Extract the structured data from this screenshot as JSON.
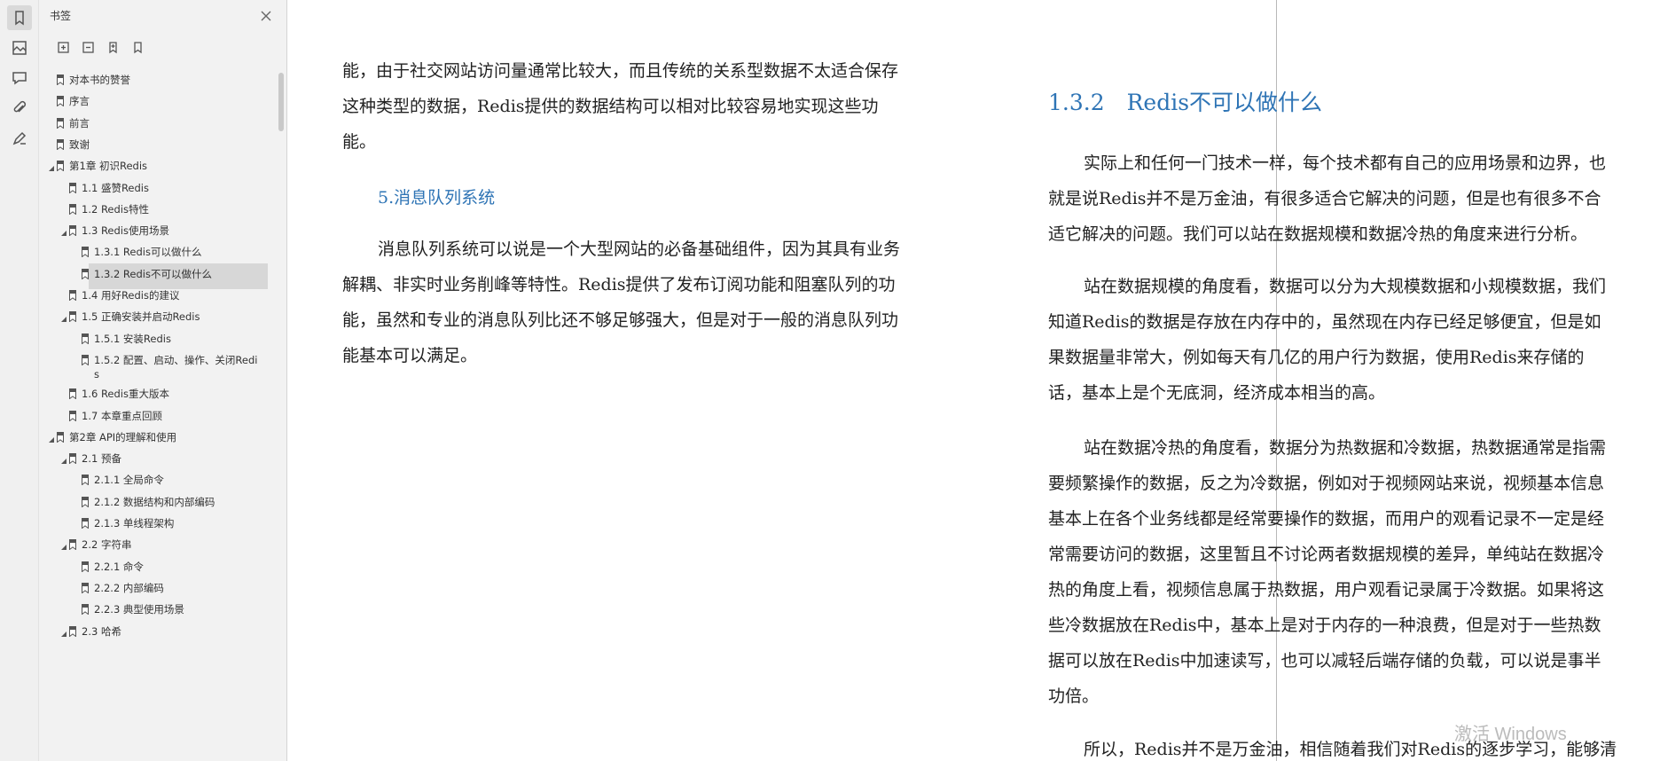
{
  "panel": {
    "title": "书签",
    "tree": [
      {
        "label": "对本书的赞誉",
        "level": 0,
        "expanded": null
      },
      {
        "label": "序言",
        "level": 0,
        "expanded": null
      },
      {
        "label": "前言",
        "level": 0,
        "expanded": null
      },
      {
        "label": "致谢",
        "level": 0,
        "expanded": null
      },
      {
        "label": "第1章 初识Redis",
        "level": 0,
        "expanded": true
      },
      {
        "label": "1.1 盛赞Redis",
        "level": 1,
        "expanded": null
      },
      {
        "label": "1.2 Redis特性",
        "level": 1,
        "expanded": null
      },
      {
        "label": "1.3 Redis使用场景",
        "level": 1,
        "expanded": true
      },
      {
        "label": "1.3.1 Redis可以做什么",
        "level": 2,
        "expanded": null
      },
      {
        "label": "1.3.2 Redis不可以做什么",
        "level": 2,
        "expanded": null,
        "selected": true
      },
      {
        "label": "1.4 用好Redis的建议",
        "level": 1,
        "expanded": null
      },
      {
        "label": "1.5 正确安装并启动Redis",
        "level": 1,
        "expanded": true
      },
      {
        "label": "1.5.1 安装Redis",
        "level": 2,
        "expanded": null
      },
      {
        "label": "1.5.2 配置、启动、操作、关闭Redis",
        "level": 2,
        "expanded": null
      },
      {
        "label": "1.6 Redis重大版本",
        "level": 1,
        "expanded": null
      },
      {
        "label": "1.7 本章重点回顾",
        "level": 1,
        "expanded": null
      },
      {
        "label": "第2章 API的理解和使用",
        "level": 0,
        "expanded": true
      },
      {
        "label": "2.1 预备",
        "level": 1,
        "expanded": true
      },
      {
        "label": "2.1.1 全局命令",
        "level": 2,
        "expanded": null
      },
      {
        "label": "2.1.2 数据结构和内部编码",
        "level": 2,
        "expanded": null
      },
      {
        "label": "2.1.3 单线程架构",
        "level": 2,
        "expanded": null
      },
      {
        "label": "2.2 字符串",
        "level": 1,
        "expanded": true
      },
      {
        "label": "2.2.1 命令",
        "level": 2,
        "expanded": null
      },
      {
        "label": "2.2.2 内部编码",
        "level": 2,
        "expanded": null
      },
      {
        "label": "2.2.3 典型使用场景",
        "level": 2,
        "expanded": null
      },
      {
        "label": "2.3 哈希",
        "level": 1,
        "expanded": true
      }
    ]
  },
  "left_page": {
    "lines_p1": [
      "能，由于社交网站访问量通常比较大，而且传统的关系型数据不太适合保存",
      "这种类型的数据，Redis提供的数据结构可以相对比较容易地实现这些功",
      "能。"
    ],
    "subheading": "5.消息队列系统",
    "lines_p2": [
      "消息队列系统可以说是一个大型网站的必备基础组件，因为其具有业务",
      "解耦、非实时业务削峰等特性。Redis提供了发布订阅功能和阻塞队列的功",
      "能，虽然和专业的消息队列比还不够足够强大，但是对于一般的消息队列功",
      "能基本可以满足。"
    ]
  },
  "right_page": {
    "heading": "1.3.2　Redis不可以做什么",
    "lines_p1": [
      "实际上和任何一门技术一样，每个技术都有自己的应用场景和边界，也",
      "就是说Redis并不是万金油，有很多适合它解决的问题，但是也有很多不合",
      "适它解决的问题。我们可以站在数据规模和数据冷热的角度来进行分析。"
    ],
    "lines_p2": [
      "站在数据规模的角度看，数据可以分为大规模数据和小规模数据，我们",
      "知道Redis的数据是存放在内存中的，虽然现在内存已经足够便宜，但是如",
      "果数据量非常大，例如每天有几亿的用户行为数据，使用Redis来存储的",
      "话，基本上是个无底洞，经济成本相当的高。"
    ],
    "lines_p3": [
      "站在数据冷热的角度看，数据分为热数据和冷数据，热数据通常是指需",
      "要频繁操作的数据，反之为冷数据，例如对于视频网站来说，视频基本信息",
      "基本上在各个业务线都是经常要操作的数据，而用户的观看记录不一定是经",
      "常需要访问的数据，这里暂且不讨论两者数据规模的差异，单纯站在数据冷",
      "热的角度上看，视频信息属于热数据，用户观看记录属于冷数据。如果将这",
      "些冷数据放在Redis中，基本上是对于内存的一种浪费，但是对于一些热数",
      "据可以放在Redis中加速读写，也可以减轻后端存储的负载，可以说是事半",
      "功倍。"
    ],
    "lines_p4": [
      "所以，Redis并不是万金油，相信随着我们对Redis的逐步学习，能够清"
    ]
  },
  "watermark": "激活 Windows",
  "colors": {
    "heading": "#2e74b5",
    "panel_bg": "#f2f2f2",
    "selected_bg": "#d7d7d7"
  }
}
